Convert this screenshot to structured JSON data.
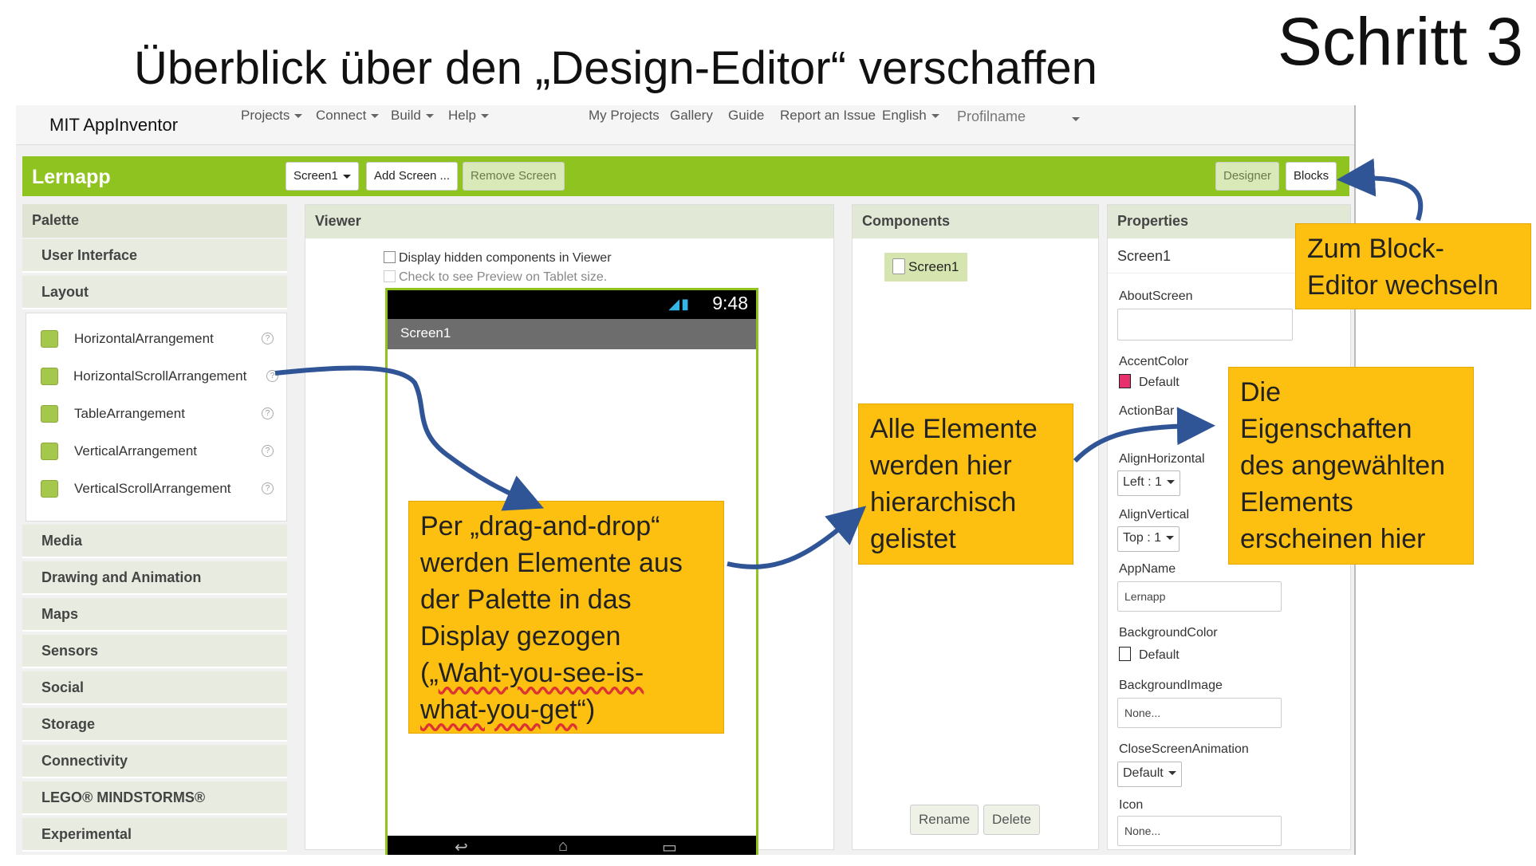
{
  "slide": {
    "step": "Schritt 3",
    "title": "Überblick über den „Design-Editor“ verschaffen"
  },
  "topbar": {
    "brand": "MIT AppInventor",
    "menus": [
      "Projects",
      "Connect",
      "Build",
      "Help"
    ],
    "links": [
      "My Projects",
      "Gallery",
      "Guide",
      "Report an Issue"
    ],
    "language": "English",
    "profile": "Profilname"
  },
  "greenbar": {
    "project_name": "Lernapp",
    "screen_select": "Screen1",
    "add_screen": "Add Screen ...",
    "remove_screen": "Remove Screen",
    "designer": "Designer",
    "blocks": "Blocks",
    "colors": {
      "green": "#8fc31f"
    }
  },
  "palette": {
    "title": "Palette",
    "categories_top": [
      "User Interface",
      "Layout"
    ],
    "layout_items": [
      "HorizontalArrangement",
      "HorizontalScrollArrangement",
      "TableArrangement",
      "VerticalArrangement",
      "VerticalScrollArrangement"
    ],
    "help_glyph": "?",
    "categories_bottom": [
      "Media",
      "Drawing and Animation",
      "Maps",
      "Sensors",
      "Social",
      "Storage",
      "Connectivity",
      "LEGO® MINDSTORMS®",
      "Experimental"
    ]
  },
  "viewer": {
    "title": "Viewer",
    "check_hidden": "Display hidden components in Viewer",
    "check_tablet": "Check to see Preview on Tablet size.",
    "phone_time": "9:48",
    "phone_screen_title": "Screen1"
  },
  "components": {
    "title": "Components",
    "tree_root": "Screen1",
    "rename": "Rename",
    "delete": "Delete"
  },
  "properties": {
    "title": "Properties",
    "selected": "Screen1",
    "about_label": "AboutScreen",
    "accent_label": "AccentColor",
    "accent_value": "Default",
    "accent_color": "#e8306c",
    "actionbar_label": "ActionBar",
    "align_h_label": "AlignHorizontal",
    "align_h_value": "Left : 1",
    "align_v_label": "AlignVertical",
    "align_v_value": "Top : 1",
    "appname_label": "AppName",
    "appname_value": "Lernapp",
    "bgcolor_label": "BackgroundColor",
    "bgcolor_value": "Default",
    "bgimage_label": "BackgroundImage",
    "bgimage_value": "None...",
    "close_anim_label": "CloseScreenAnimation",
    "close_anim_value": "Default",
    "icon_label": "Icon",
    "icon_value": "None..."
  },
  "callouts": {
    "block_editor": [
      "Zum Block-",
      "Editor wechseln"
    ],
    "drag_drop": [
      "Per „drag-and-drop“",
      "werden Elemente aus",
      "der Palette in das",
      "Display gezogen",
      "(„",
      "Waht-you-see-is-",
      "what-you-get",
      "“)"
    ],
    "components": [
      "Alle Elemente",
      "werden hier",
      "hierarchisch",
      "gelistet"
    ],
    "properties": [
      "Die",
      "Eigenschaften",
      "des angewählten",
      "Elements",
      "erscheinen hier"
    ],
    "color": "#fdc010",
    "arrow_color": "#2f5597"
  }
}
